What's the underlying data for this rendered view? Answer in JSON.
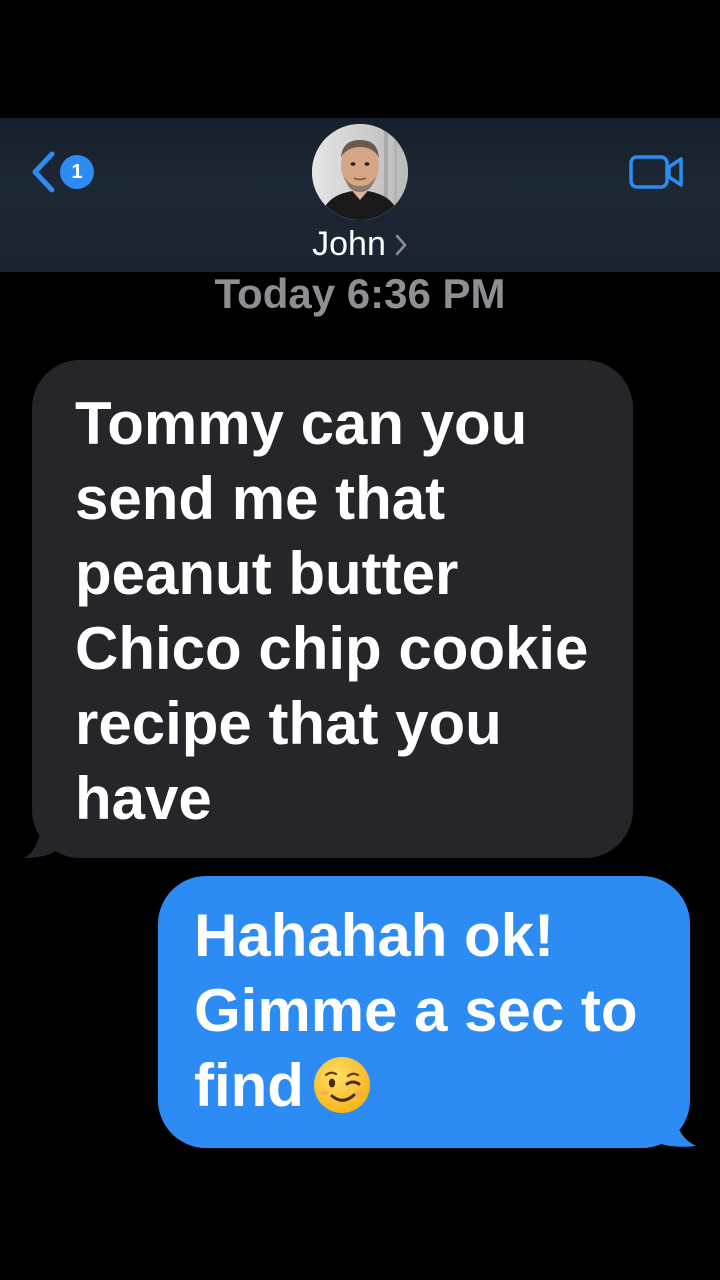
{
  "header": {
    "back_badge_count": "1",
    "contact_name": "John",
    "back_icon": "chevron-left-icon",
    "video_icon": "video-camera-icon",
    "accent_color": "#2c8cf4"
  },
  "conversation": {
    "timestamp": "Today 6:36 PM",
    "messages": [
      {
        "direction": "received",
        "lines": [
          "Tommy can you",
          "send me that",
          "peanut butter",
          "Chico chip cookie",
          "recipe that you",
          "have"
        ]
      },
      {
        "direction": "sent",
        "lines": [
          "Hahahah ok!",
          "Gimme a sec to",
          "find"
        ],
        "emoji": "winking-face-emoji"
      }
    ]
  },
  "colors": {
    "background": "#000000",
    "received_bubble": "#26252a",
    "sent_bubble": "#2c8cf4",
    "timestamp_text": "#8e8e93"
  }
}
